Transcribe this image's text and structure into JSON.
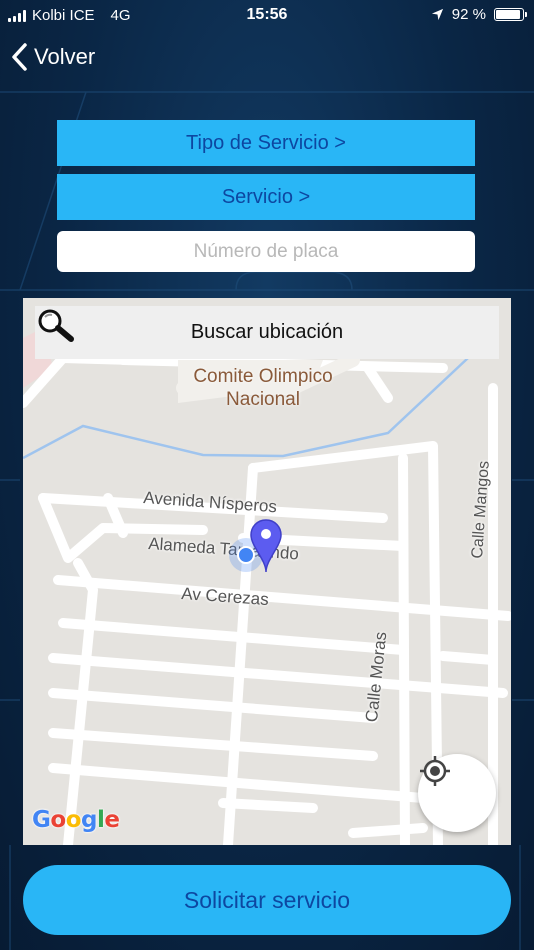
{
  "status_bar": {
    "carrier": "Kolbi ICE",
    "network": "4G",
    "time": "15:56",
    "battery_pct": "92 %",
    "battery_level": 0.92,
    "location_icon": "location-arrow-icon"
  },
  "nav": {
    "back_label": "Volver",
    "back_icon": "chevron-left-icon"
  },
  "form": {
    "service_type_label": "Tipo de Servicio >",
    "service_label": "Servicio >",
    "plate_value": "",
    "plate_placeholder": "Número de placa"
  },
  "map": {
    "search_placeholder": "Buscar ubicación",
    "search_icon": "magnifier-icon",
    "poi_line1": "Comite Olimpico",
    "poi_line2": "Nacional",
    "streets": {
      "nisperos": "Avenida Nísperos",
      "tamarindo": "Alameda Tamarindo",
      "cerezas": "Av Cerezas",
      "moras": "Calle Moras",
      "mangos": "Calle Mangos"
    },
    "locate_icon": "my-location-icon",
    "pin_icon": "map-pin-icon",
    "provider_logo": "Google"
  },
  "actions": {
    "submit_label": "Solicitar servicio"
  },
  "colors": {
    "accent": "#29b6f6",
    "accent_text": "#0d47a1",
    "background": "#0a2645",
    "pin": "#5c5cf0",
    "user_dot": "#4285f4"
  }
}
